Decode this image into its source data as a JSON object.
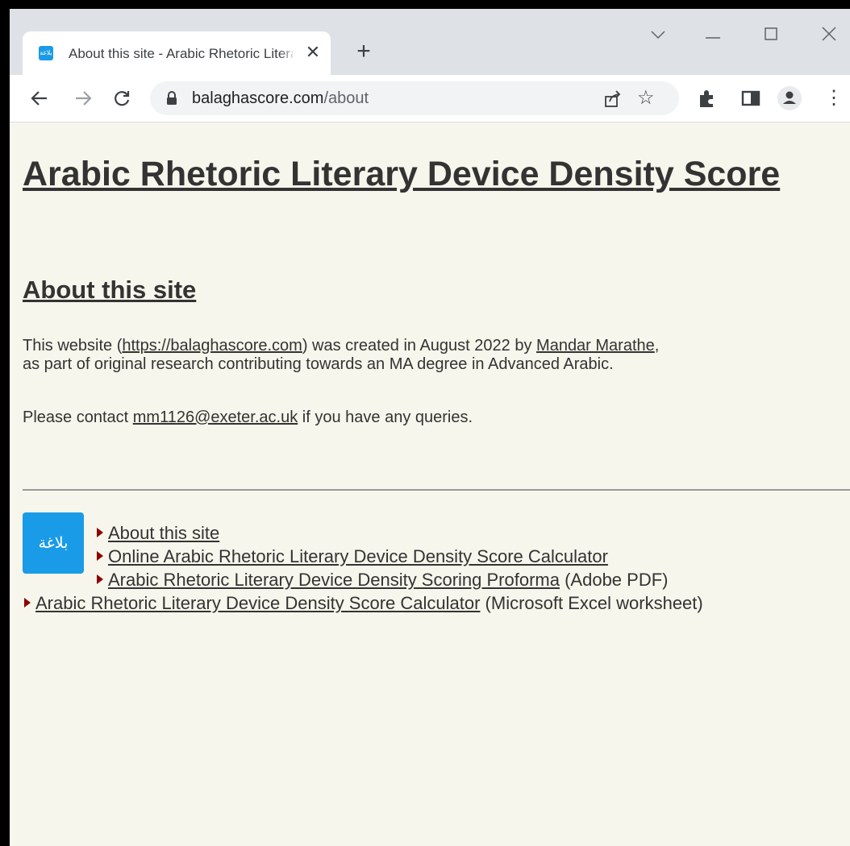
{
  "browser": {
    "tab_title": "About this site - Arabic Rhetoric Literary Device Density Score",
    "favicon_text": "بلاغة",
    "url_host": "balaghascore.com",
    "url_path": "/about"
  },
  "page": {
    "heading": "Arabic Rhetoric Literary Device Density Score",
    "subheading": "About this site",
    "intro": {
      "t1": "This website (",
      "site_link": "https://balaghascore.com",
      "t2": ") was created in August 2022 by ",
      "author_link": "Mandar Marathe",
      "t3": ",",
      "line2": "as part of original research contributing towards an MA degree in Advanced Arabic."
    },
    "contact": {
      "t1": "Please contact ",
      "email_link": "mm1126@exeter.ac.uk",
      "t2": " if you have any queries."
    },
    "logo_text": "بلاغة",
    "nav": [
      {
        "label": "About this site",
        "suffix": ""
      },
      {
        "label": "Online Arabic Rhetoric Literary Device Density Score Calculator",
        "suffix": ""
      },
      {
        "label": "Arabic Rhetoric Literary Device Density Scoring Proforma",
        "suffix": " (Adobe PDF)"
      },
      {
        "label": "Arabic Rhetoric Literary Device Density Score Calculator",
        "suffix": " (Microsoft Excel worksheet)"
      }
    ]
  },
  "colors": {
    "page_bg": "#f7f6ec",
    "text": "#333333",
    "bullet": "#8b0000",
    "logo_bg": "#1a9be8"
  }
}
